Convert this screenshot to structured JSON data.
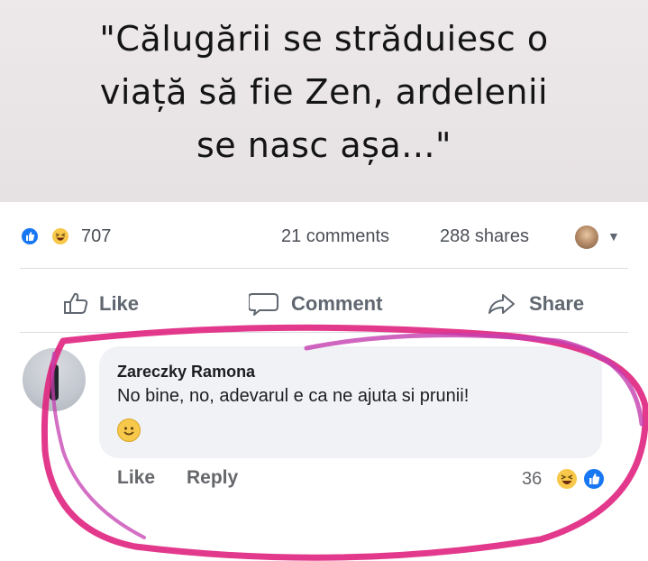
{
  "quote": {
    "lines": [
      "\"Călugării se străduiesc o",
      "viață să fie Zen, ardelenii",
      "se nasc așa...\""
    ]
  },
  "post_stats": {
    "reaction_count": "707",
    "reaction_icons": [
      "like-icon",
      "haha-icon"
    ],
    "comments": "21 comments",
    "shares": "288 shares"
  },
  "post_actions": {
    "like_label": "Like",
    "comment_label": "Comment",
    "share_label": "Share"
  },
  "comment": {
    "author": "Zareczky Ramona",
    "text": "No bine, no, adevarul e ca ne ajuta si prunii!",
    "emoji": "smile-icon",
    "like_label": "Like",
    "reply_label": "Reply",
    "reaction_count": "36",
    "reaction_icons": [
      "haha-icon",
      "like-icon"
    ]
  },
  "colors": {
    "facebook_blue": "#1877f2",
    "annotation_circle": "#e0247f"
  }
}
